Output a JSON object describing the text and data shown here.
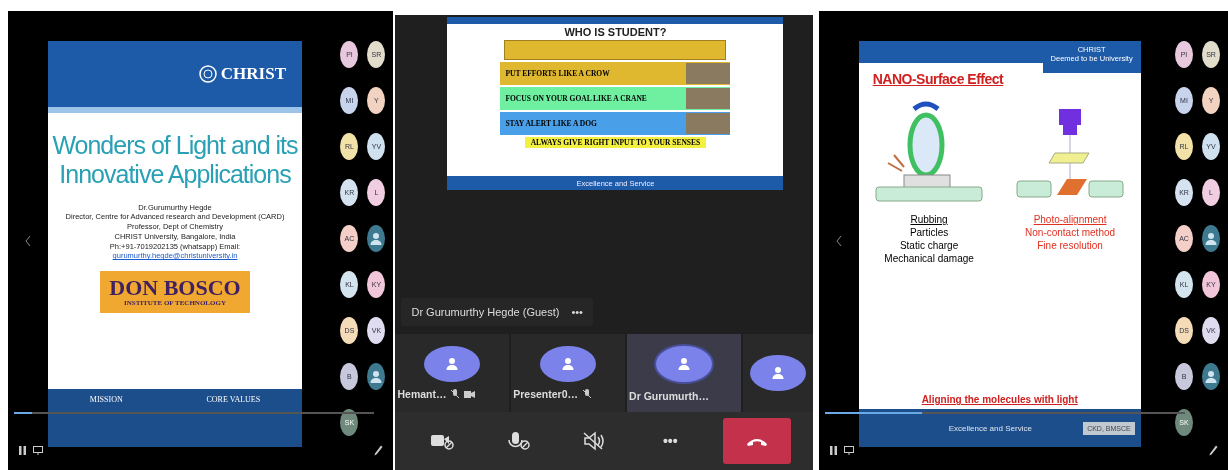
{
  "left_view": {
    "slide": {
      "kind": "title",
      "logo": "CHRIST",
      "title_lines": [
        "Wonders of Light and its",
        "Innovative Applications"
      ],
      "details": [
        "Dr.Gurumurthy Hegde",
        "Director, Centre for Advanced research and Development (CARD)",
        "Professor, Dept of Chemistry",
        "CHRIST University, Bangalore, India"
      ],
      "contact": "Ph:+91-7019202135 (whatsapp)  Email:",
      "email": "gurumurthy.hegde@christuniversity.in",
      "banner": {
        "name": "DON BOSCO",
        "subtitle": "INSTITUTE OF TECHNOLOGY"
      },
      "footer": [
        "MISSION",
        "CORE VALUES"
      ]
    },
    "seek": {
      "level": 0.05
    },
    "participants": [
      {
        "kind": "initials",
        "initials": "PI",
        "color": "#e8c8dc"
      },
      {
        "kind": "initials",
        "initials": "SR",
        "color": "#e2dccb"
      },
      {
        "kind": "initials",
        "initials": "MI",
        "color": "#c7d4ec"
      },
      {
        "kind": "initials",
        "initials": "Y",
        "color": "#f2d2c0"
      },
      {
        "kind": "initials",
        "initials": "RL",
        "color": "#f2e2a8"
      },
      {
        "kind": "initials",
        "initials": "YV",
        "color": "#cfe0ee"
      },
      {
        "kind": "initials",
        "initials": "KR",
        "color": "#d5e2ef"
      },
      {
        "kind": "initials",
        "initials": "L",
        "color": "#f0cde0"
      },
      {
        "kind": "initials",
        "initials": "AC",
        "color": "#f3cfc8"
      },
      {
        "kind": "icon",
        "color": "#3d7a90"
      },
      {
        "kind": "initials",
        "initials": "KL",
        "color": "#d4e4ee"
      },
      {
        "kind": "initials",
        "initials": "KY",
        "color": "#f0c6d8"
      },
      {
        "kind": "initials",
        "initials": "DS",
        "color": "#f4dcb8"
      },
      {
        "kind": "initials",
        "initials": "VK",
        "color": "#e0dcf0"
      },
      {
        "kind": "initials",
        "initials": "B",
        "color": "#c8c8dc"
      },
      {
        "kind": "icon",
        "color": "#3d7a90"
      },
      {
        "kind": "initials",
        "initials": "SK",
        "color": "#6f8a7c"
      }
    ]
  },
  "call_view": {
    "slide": {
      "title": "WHO IS STUDENT?",
      "rows": [
        {
          "text": "PUT EFFORTS LIKE A CROW",
          "color": "#e0b830"
        },
        {
          "text": "FOCUS ON YOUR GOAL LIKE A CRANE",
          "color": "#6ef0a0"
        },
        {
          "text": "STAY ALERT LIKE A DOG",
          "color": "#4aa0e8"
        }
      ],
      "closing": "ALWAYS GIVE RIGHT INPUT TO YOUR SENSES",
      "footer": "Excellence and Service"
    },
    "speaker": {
      "name": "Dr Gurumurthy Hegde (Guest)",
      "more": "•••"
    },
    "tiles": [
      {
        "name": "Hemant…",
        "muted": true,
        "video_off": true,
        "selected": false
      },
      {
        "name": "Presenter0…",
        "muted": true,
        "video_off": false,
        "selected": false
      },
      {
        "name": "Dr Gurumurth…",
        "muted": false,
        "video_off": false,
        "selected": true
      },
      {
        "muted": false,
        "video_off": false,
        "selected": false
      }
    ],
    "controls": [
      {
        "kind": "camera"
      },
      {
        "kind": "mic"
      },
      {
        "kind": "speaker"
      },
      {
        "kind": "more",
        "label": "•••"
      },
      {
        "kind": "hangup"
      }
    ]
  },
  "right_view": {
    "slide": {
      "kind": "diagram",
      "logo": "CHRIST",
      "logo_sub": "Deemed to be University",
      "title": "NANO-Surface Effect",
      "left_points": [
        "Rubbing",
        "Particles",
        "Static charge",
        "Mechanical damage"
      ],
      "right_points": [
        "Photo-alignment",
        "Non-contact method",
        "Fine resolution"
      ],
      "caption": "Aligning the molecules with light",
      "footer": "Excellence and Service",
      "tag": "CKD, BMSCE"
    },
    "seek": {
      "level": 0.27
    },
    "participants": [
      {
        "kind": "initials",
        "initials": "PI",
        "color": "#e8c8dc"
      },
      {
        "kind": "initials",
        "initials": "SR",
        "color": "#e2dccb"
      },
      {
        "kind": "initials",
        "initials": "MI",
        "color": "#c7d4ec"
      },
      {
        "kind": "initials",
        "initials": "Y",
        "color": "#f2d2c0"
      },
      {
        "kind": "initials",
        "initials": "RL",
        "color": "#f2e2a8"
      },
      {
        "kind": "initials",
        "initials": "YV",
        "color": "#cfe0ee"
      },
      {
        "kind": "initials",
        "initials": "KR",
        "color": "#d5e2ef"
      },
      {
        "kind": "initials",
        "initials": "L",
        "color": "#f0cde0"
      },
      {
        "kind": "initials",
        "initials": "AC",
        "color": "#f3cfc8"
      },
      {
        "kind": "icon",
        "color": "#3d7a90"
      },
      {
        "kind": "initials",
        "initials": "KL",
        "color": "#d4e4ee"
      },
      {
        "kind": "initials",
        "initials": "KY",
        "color": "#f0c6d8"
      },
      {
        "kind": "initials",
        "initials": "DS",
        "color": "#f4dcb8"
      },
      {
        "kind": "initials",
        "initials": "VK",
        "color": "#e0dcf0"
      },
      {
        "kind": "initials",
        "initials": "B",
        "color": "#c8c8dc"
      },
      {
        "kind": "icon",
        "color": "#3d7a90"
      },
      {
        "kind": "initials",
        "initials": "SK",
        "color": "#6f8a7c"
      }
    ]
  }
}
